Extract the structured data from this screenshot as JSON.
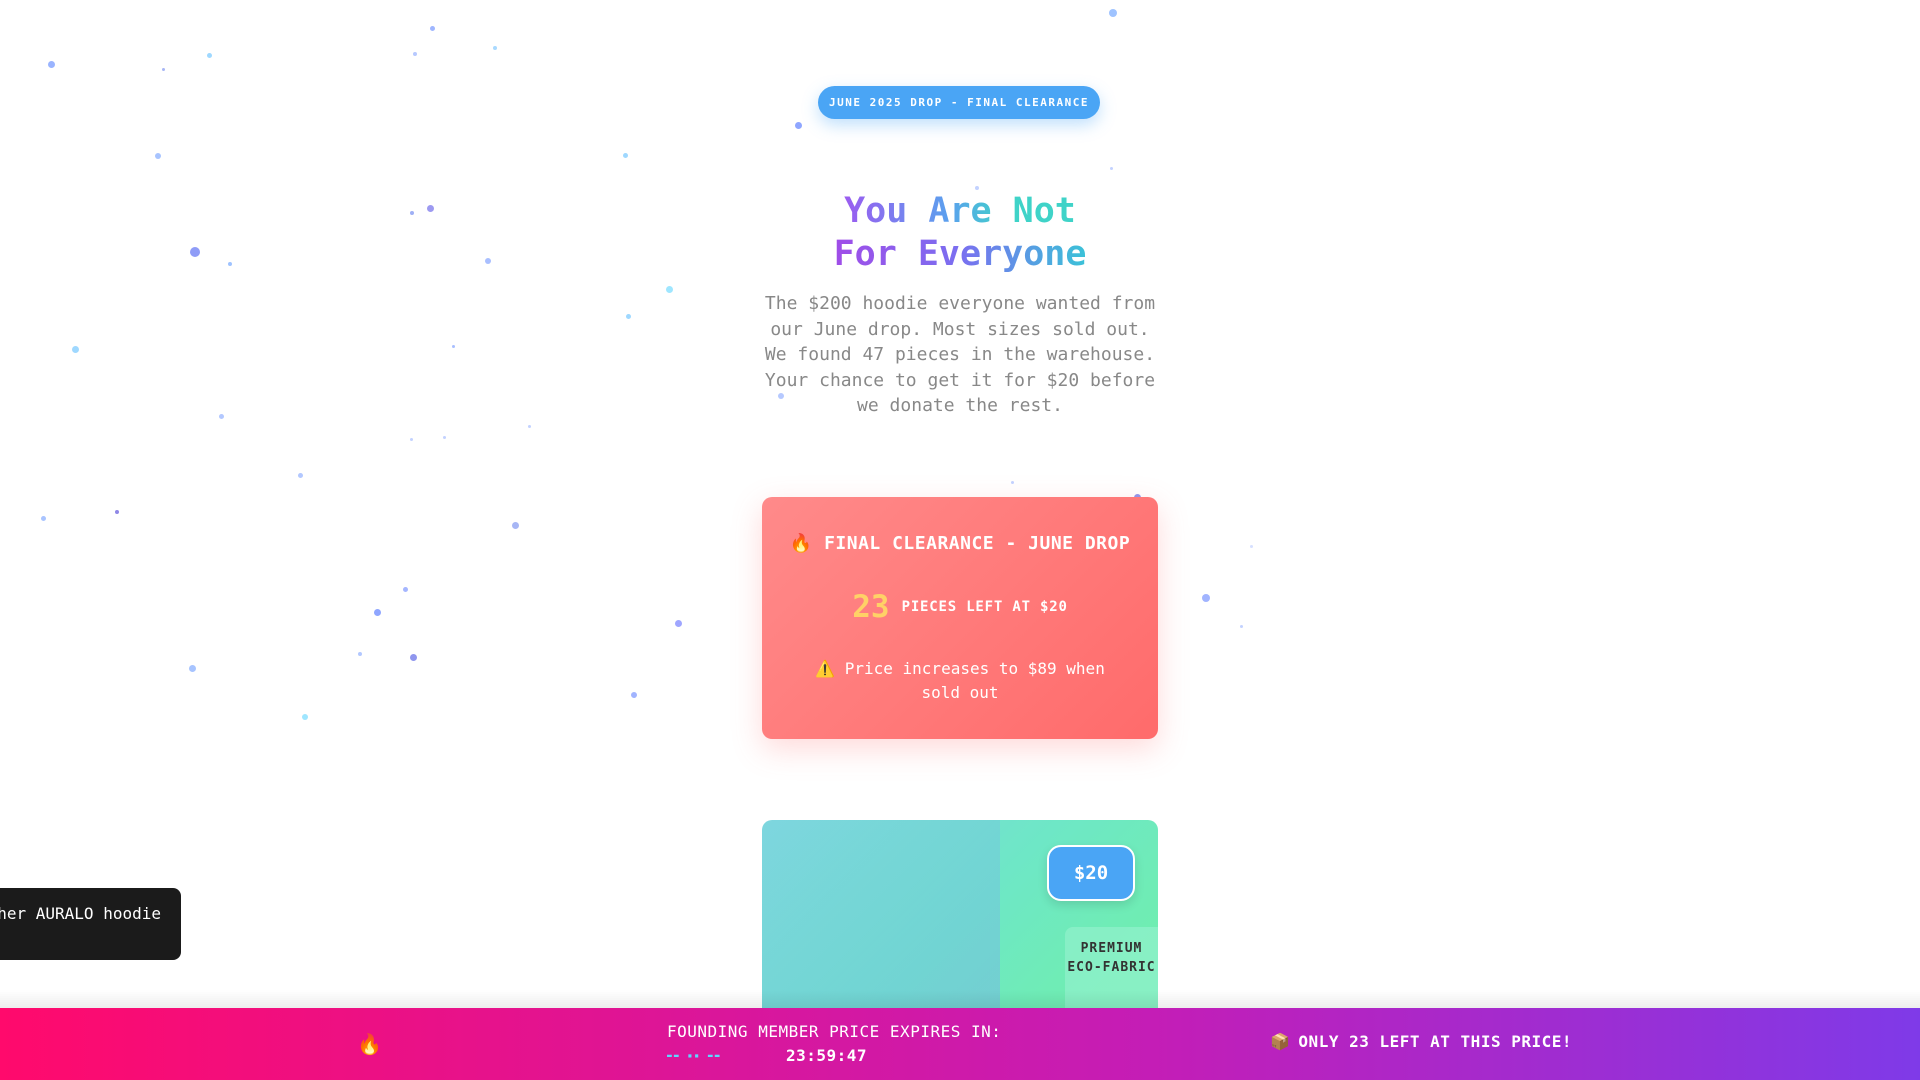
{
  "badge": {
    "label": "JUNE 2025 DROP - FINAL CLEARANCE"
  },
  "hero": {
    "line1": "You Are Not",
    "line2": "For Everyone",
    "subcopy": "The $200 hoodie everyone wanted from our June drop. Most sizes sold out. We found 47 pieces in the warehouse. Your chance to get it for $20 before we donate the rest."
  },
  "clearance": {
    "icon": "fire-icon",
    "icon_glyph": "🔥",
    "title": "FINAL CLEARANCE - JUNE DROP",
    "stock_count": "23",
    "stock_label": "PIECES LEFT AT $20",
    "warning_icon": "warning-icon",
    "warning_glyph": "⚠️",
    "warning_text": "Price increases to $89 when sold out"
  },
  "product": {
    "price": "$20",
    "fabric_badge": "PREMIUM ECO-FABRIC"
  },
  "toast": {
    "text": "her AURALO hoodie"
  },
  "urgency_bar": {
    "fire_icon": "fire-icon",
    "fire_glyph": "🔥",
    "timer_label": "FOUNDING MEMBER PRICE EXPIRES IN:",
    "timer_dashes": "▬▬ ▪▪ ▬▬",
    "timer_value": "23:59:47",
    "stock_icon": "package-icon",
    "stock_glyph": "📦",
    "stock_alert": "ONLY 23 LEFT AT THIS PRICE!"
  },
  "colors": {
    "accent_blue": "#4aa5f5",
    "clearance_red": "#ff6b6b",
    "stock_yellow": "#ffd166",
    "bar_pink": "#ff0a6c",
    "bar_purple": "#7f3ae8"
  }
}
